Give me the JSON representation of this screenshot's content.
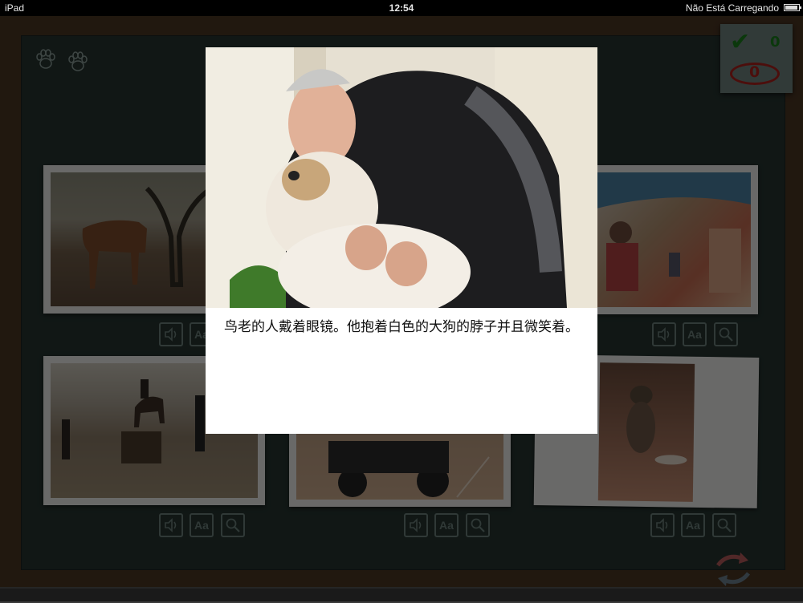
{
  "status_bar": {
    "device": "iPad",
    "time": "12:54",
    "charging": "Não Está Carregando"
  },
  "score": {
    "correct_count": "0",
    "wrong_count": "0"
  },
  "tools": {
    "text_label": "Aa"
  },
  "modal": {
    "caption": "鸟老的人戴着眼镜。他抱着白色的大狗的脖子并且微笑着。"
  },
  "colors": {
    "board": "#263430",
    "frame": "#4a3523",
    "chalk": "#6b7f7a",
    "correct": "#1a7d1c",
    "wrong": "#a8211c"
  },
  "icons": [
    "paw-icon",
    "checkmark-icon",
    "wrong-oval-icon",
    "speaker-icon",
    "magnifier-icon",
    "refresh-icon",
    "battery-icon"
  ]
}
